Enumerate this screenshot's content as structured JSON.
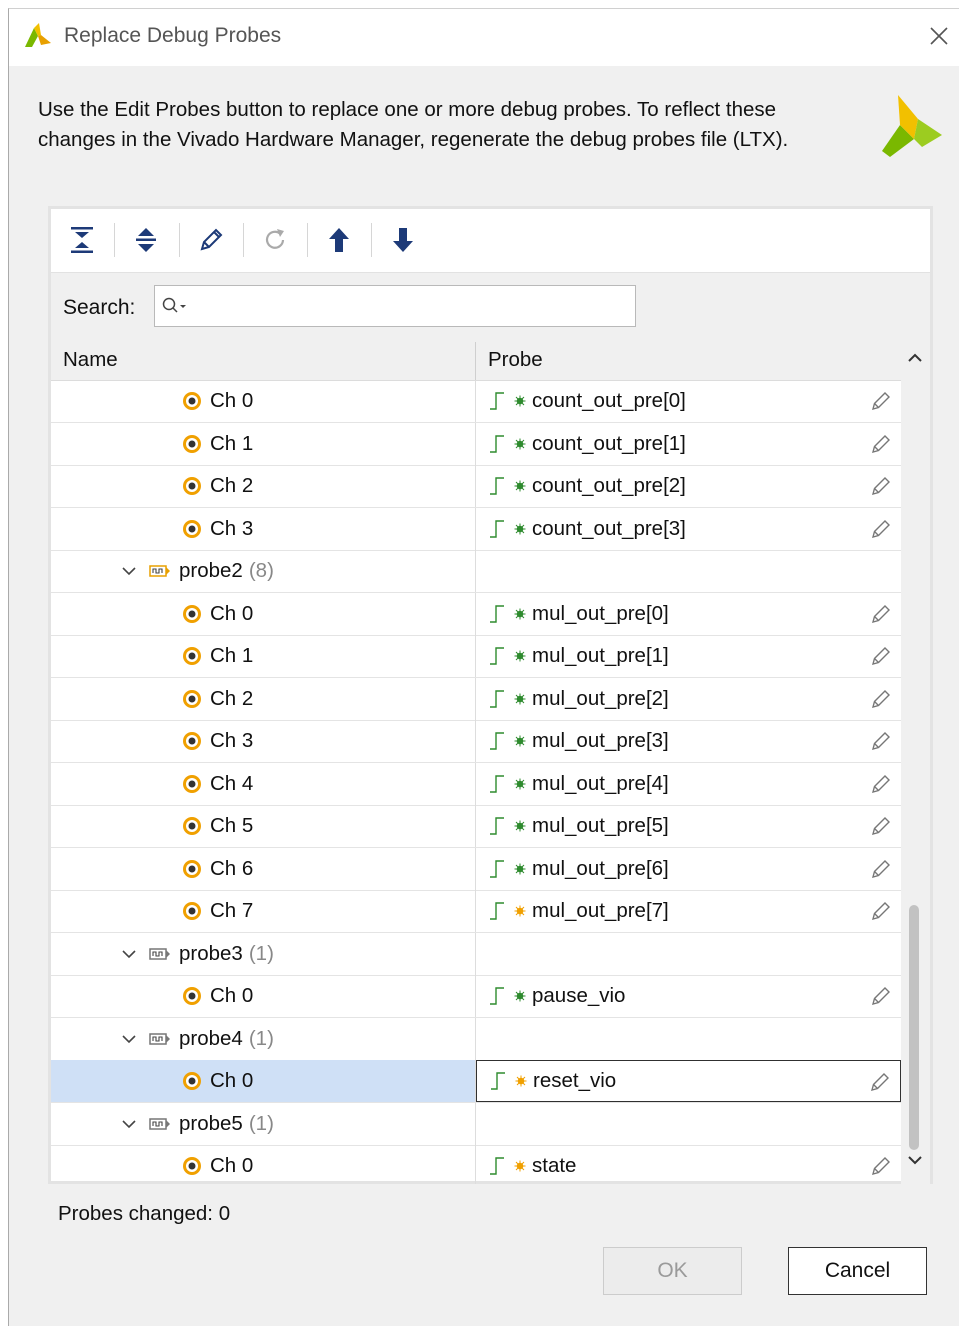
{
  "window": {
    "title": "Replace Debug Probes",
    "description_line1": "Use the Edit Probes button to replace one or more debug probes. To reflect these",
    "description_line2": "changes in the Vivado Hardware Manager, regenerate the debug probes file (LTX)."
  },
  "toolbar": {
    "buttons": [
      "collapse-all-icon",
      "expand-all-icon",
      "edit-icon",
      "refresh-icon",
      "move-up-icon",
      "move-down-icon"
    ]
  },
  "search": {
    "label": "Search:",
    "value": ""
  },
  "table": {
    "columns": [
      "Name",
      "Probe"
    ],
    "rows": [
      {
        "kind": "ch",
        "name": "Ch 0",
        "probe": "count_out_pre[0]",
        "status": "green"
      },
      {
        "kind": "ch",
        "name": "Ch 1",
        "probe": "count_out_pre[1]",
        "status": "green"
      },
      {
        "kind": "ch",
        "name": "Ch 2",
        "probe": "count_out_pre[2]",
        "status": "green"
      },
      {
        "kind": "ch",
        "name": "Ch 3",
        "probe": "count_out_pre[3]",
        "status": "green"
      },
      {
        "kind": "group",
        "name": "probe2",
        "count": "(8)",
        "icon": "orange"
      },
      {
        "kind": "ch",
        "name": "Ch 0",
        "probe": "mul_out_pre[0]",
        "status": "green"
      },
      {
        "kind": "ch",
        "name": "Ch 1",
        "probe": "mul_out_pre[1]",
        "status": "green"
      },
      {
        "kind": "ch",
        "name": "Ch 2",
        "probe": "mul_out_pre[2]",
        "status": "green"
      },
      {
        "kind": "ch",
        "name": "Ch 3",
        "probe": "mul_out_pre[3]",
        "status": "green"
      },
      {
        "kind": "ch",
        "name": "Ch 4",
        "probe": "mul_out_pre[4]",
        "status": "green"
      },
      {
        "kind": "ch",
        "name": "Ch 5",
        "probe": "mul_out_pre[5]",
        "status": "green"
      },
      {
        "kind": "ch",
        "name": "Ch 6",
        "probe": "mul_out_pre[6]",
        "status": "green"
      },
      {
        "kind": "ch",
        "name": "Ch 7",
        "probe": "mul_out_pre[7]",
        "status": "orange"
      },
      {
        "kind": "group",
        "name": "probe3",
        "count": "(1)",
        "icon": "gray"
      },
      {
        "kind": "ch",
        "name": "Ch 0",
        "probe": "pause_vio",
        "status": "green"
      },
      {
        "kind": "group",
        "name": "probe4",
        "count": "(1)",
        "icon": "gray"
      },
      {
        "kind": "ch",
        "name": "Ch 0",
        "probe": "reset_vio",
        "status": "orange",
        "selected": true
      },
      {
        "kind": "group",
        "name": "probe5",
        "count": "(1)",
        "icon": "gray"
      },
      {
        "kind": "ch",
        "name": "Ch 0",
        "probe": "state",
        "status": "orange"
      }
    ]
  },
  "footer": {
    "changed_text": "Probes changed: 0",
    "ok_label": "OK",
    "cancel_label": "Cancel"
  },
  "colors": {
    "selected_row": "#cfe0f6",
    "radio_orange": "#f0a000",
    "status_green": "#2e8b2e",
    "status_orange": "#f0a000",
    "logo_green": "#7ab800",
    "logo_yellow": "#f2c000"
  }
}
